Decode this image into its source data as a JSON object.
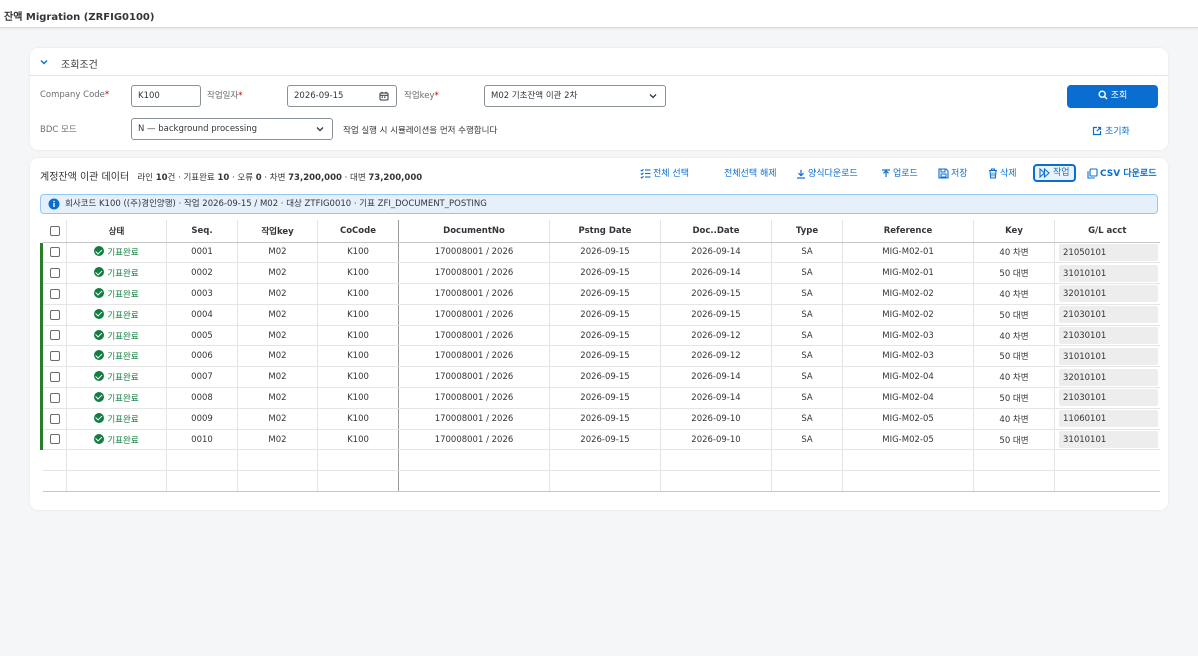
{
  "app": {
    "title": "잔액 Migration (ZRFIG0100)"
  },
  "filter": {
    "title": "조회조건",
    "company_code_label": "Company Code",
    "company_code_value": "K100",
    "work_date_label": "작업일자",
    "work_date_value": "2026-09-15",
    "work_key_label": "작업key",
    "work_key_value": "M02 기초잔액 이관 2차",
    "bdc_label": "BDC 모드",
    "bdc_value": "N — background processing",
    "hint": "작업 실행 시 시뮬레이션을 먼저 수행합니다",
    "search_button": "조회",
    "reset_button": "초기화",
    "required_mark": "*"
  },
  "table": {
    "title": "계정잔액 이관 데이터",
    "stats": {
      "lines_prefix": "라인 ",
      "lines": "10",
      "lines_suffix": "건 · 기표완료 ",
      "posted": "10",
      "errors_prefix": " · 오류 ",
      "errors": "0",
      "debit_prefix": " · 차변 ",
      "debit": "73,200,000",
      "credit_prefix": " · 대변 ",
      "credit": "73,200,000"
    },
    "toolbar": {
      "select_all": "전체 선택",
      "deselect_all": "전체선택 해제",
      "template_download": "양식다운로드",
      "upload": "업로드",
      "save": "저장",
      "delete": "삭제",
      "run": "작업",
      "csv_download": "CSV 다운로드"
    },
    "info": "회사코드 K100 ((주)경인양행) · 작업 2026-09-15 / M02 · 대상 ZTFIG0010 · 기표 ZFI_DOCUMENT_POSTING",
    "columns": [
      "상태",
      "Seq.",
      "작업key",
      "CoCode",
      "DocumentNo",
      "Pstng Date",
      "Doc..Date",
      "Type",
      "Reference",
      "Key",
      "G/L acct"
    ],
    "rows": [
      {
        "status": "기표완료",
        "seq": "0001",
        "key": "M02",
        "cocode": "K100",
        "docno": "170008001 / 2026",
        "pdate": "2026-09-15",
        "ddate": "2026-09-14",
        "type": "SA",
        "ref": "MIG-M02-01",
        "pk": "40 차변",
        "gl": "21050101"
      },
      {
        "status": "기표완료",
        "seq": "0002",
        "key": "M02",
        "cocode": "K100",
        "docno": "170008001 / 2026",
        "pdate": "2026-09-15",
        "ddate": "2026-09-14",
        "type": "SA",
        "ref": "MIG-M02-01",
        "pk": "50 대변",
        "gl": "31010101"
      },
      {
        "status": "기표완료",
        "seq": "0003",
        "key": "M02",
        "cocode": "K100",
        "docno": "170008001 / 2026",
        "pdate": "2026-09-15",
        "ddate": "2026-09-15",
        "type": "SA",
        "ref": "MIG-M02-02",
        "pk": "40 차변",
        "gl": "32010101"
      },
      {
        "status": "기표완료",
        "seq": "0004",
        "key": "M02",
        "cocode": "K100",
        "docno": "170008001 / 2026",
        "pdate": "2026-09-15",
        "ddate": "2026-09-15",
        "type": "SA",
        "ref": "MIG-M02-02",
        "pk": "50 대변",
        "gl": "21030101"
      },
      {
        "status": "기표완료",
        "seq": "0005",
        "key": "M02",
        "cocode": "K100",
        "docno": "170008001 / 2026",
        "pdate": "2026-09-15",
        "ddate": "2026-09-12",
        "type": "SA",
        "ref": "MIG-M02-03",
        "pk": "40 차변",
        "gl": "21030101"
      },
      {
        "status": "기표완료",
        "seq": "0006",
        "key": "M02",
        "cocode": "K100",
        "docno": "170008001 / 2026",
        "pdate": "2026-09-15",
        "ddate": "2026-09-12",
        "type": "SA",
        "ref": "MIG-M02-03",
        "pk": "50 대변",
        "gl": "31010101"
      },
      {
        "status": "기표완료",
        "seq": "0007",
        "key": "M02",
        "cocode": "K100",
        "docno": "170008001 / 2026",
        "pdate": "2026-09-15",
        "ddate": "2026-09-14",
        "type": "SA",
        "ref": "MIG-M02-04",
        "pk": "40 차변",
        "gl": "32010101"
      },
      {
        "status": "기표완료",
        "seq": "0008",
        "key": "M02",
        "cocode": "K100",
        "docno": "170008001 / 2026",
        "pdate": "2026-09-15",
        "ddate": "2026-09-14",
        "type": "SA",
        "ref": "MIG-M02-04",
        "pk": "50 대변",
        "gl": "21030101"
      },
      {
        "status": "기표완료",
        "seq": "0009",
        "key": "M02",
        "cocode": "K100",
        "docno": "170008001 / 2026",
        "pdate": "2026-09-15",
        "ddate": "2026-09-10",
        "type": "SA",
        "ref": "MIG-M02-05",
        "pk": "40 차변",
        "gl": "11060101"
      },
      {
        "status": "기표완료",
        "seq": "0010",
        "key": "M02",
        "cocode": "K100",
        "docno": "170008001 / 2026",
        "pdate": "2026-09-15",
        "ddate": "2026-09-10",
        "type": "SA",
        "ref": "MIG-M02-05",
        "pk": "50 대변",
        "gl": "31010101"
      }
    ]
  },
  "colors": {
    "accent": "#0a6ed1",
    "success": "#107e3e",
    "error": "#bb0000"
  }
}
